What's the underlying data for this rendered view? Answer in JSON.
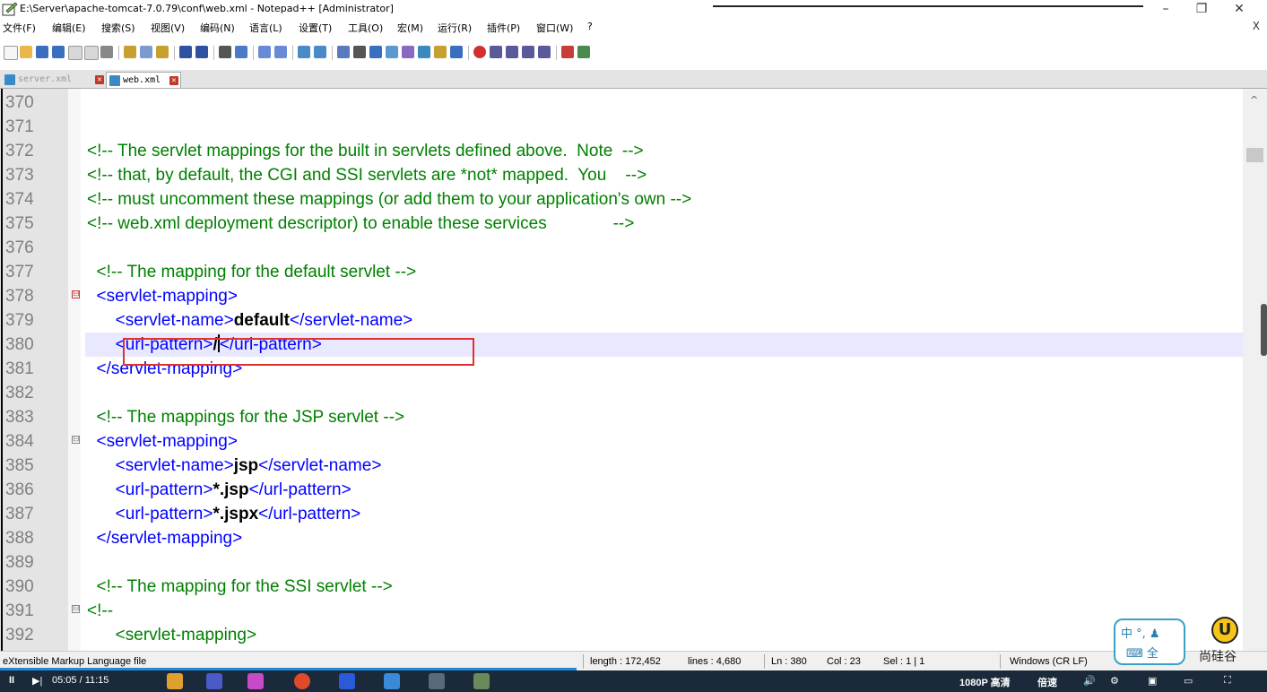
{
  "window": {
    "title": "E:\\Server\\apache-tomcat-7.0.79\\conf\\web.xml - Notepad++ [Administrator]",
    "minimize": "–",
    "restore": "❐",
    "close": "✕"
  },
  "menu": [
    {
      "label": "文件(F)"
    },
    {
      "label": "编辑(E)"
    },
    {
      "label": "搜索(S)"
    },
    {
      "label": "视图(V)"
    },
    {
      "label": "编码(N)"
    },
    {
      "label": "语言(L)"
    },
    {
      "label": "设置(T)"
    },
    {
      "label": "工具(O)"
    },
    {
      "label": "宏(M)"
    },
    {
      "label": "运行(R)"
    },
    {
      "label": "插件(P)"
    },
    {
      "label": "窗口(W)"
    },
    {
      "label": "?"
    }
  ],
  "menu_close": "X",
  "tabs": [
    {
      "label": "server.xml",
      "active": false
    },
    {
      "label": "web.xml",
      "active": true
    }
  ],
  "tab_close_glyph": "✕",
  "lines": [
    {
      "num": "370",
      "segs": []
    },
    {
      "num": "371",
      "segs": []
    },
    {
      "num": "372",
      "segs": [
        {
          "c": "cmt",
          "t": "<!-- The servlet mappings for the built in servlets defined above.  Note  -->"
        }
      ]
    },
    {
      "num": "373",
      "segs": [
        {
          "c": "cmt",
          "t": "<!-- that, by default, the CGI and SSI servlets are *not* mapped.  You    -->"
        }
      ]
    },
    {
      "num": "374",
      "segs": [
        {
          "c": "cmt",
          "t": "<!-- must uncomment these mappings (or add them to your application's own -->"
        }
      ]
    },
    {
      "num": "375",
      "segs": [
        {
          "c": "cmt",
          "t": "<!-- web.xml deployment descriptor) to enable these services              -->"
        }
      ]
    },
    {
      "num": "376",
      "segs": []
    },
    {
      "num": "377",
      "segs": [
        {
          "c": "cmt",
          "t": "  <!-- The mapping for the default servlet -->"
        }
      ]
    },
    {
      "num": "378",
      "fold": "⊟",
      "segs": [
        {
          "c": "tag",
          "t": "  <servlet-mapping>"
        }
      ]
    },
    {
      "num": "379",
      "segs": [
        {
          "c": "tag",
          "t": "      <servlet-name>"
        },
        {
          "c": "txt",
          "t": "default"
        },
        {
          "c": "tag",
          "t": "</servlet-name>"
        }
      ]
    },
    {
      "num": "380",
      "current": true,
      "segs": [
        {
          "c": "tag",
          "t": "      <url-pattern>"
        },
        {
          "c": "txt",
          "t": "/"
        },
        {
          "c": "caret",
          "t": ""
        },
        {
          "c": "tag",
          "t": "</url-pattern>"
        }
      ]
    },
    {
      "num": "381",
      "segs": [
        {
          "c": "tag",
          "t": "  </servlet-mapping>"
        }
      ]
    },
    {
      "num": "382",
      "segs": []
    },
    {
      "num": "383",
      "segs": [
        {
          "c": "cmt",
          "t": "  <!-- The mappings for the JSP servlet -->"
        }
      ]
    },
    {
      "num": "384",
      "fold": "⊟",
      "foldgray": true,
      "segs": [
        {
          "c": "tag",
          "t": "  <servlet-mapping>"
        }
      ]
    },
    {
      "num": "385",
      "segs": [
        {
          "c": "tag",
          "t": "      <servlet-name>"
        },
        {
          "c": "txt",
          "t": "jsp"
        },
        {
          "c": "tag",
          "t": "</servlet-name>"
        }
      ]
    },
    {
      "num": "386",
      "segs": [
        {
          "c": "tag",
          "t": "      <url-pattern>"
        },
        {
          "c": "txt",
          "t": "*.jsp"
        },
        {
          "c": "tag",
          "t": "</url-pattern>"
        }
      ]
    },
    {
      "num": "387",
      "segs": [
        {
          "c": "tag",
          "t": "      <url-pattern>"
        },
        {
          "c": "txt",
          "t": "*.jspx"
        },
        {
          "c": "tag",
          "t": "</url-pattern>"
        }
      ]
    },
    {
      "num": "388",
      "segs": [
        {
          "c": "tag",
          "t": "  </servlet-mapping>"
        }
      ]
    },
    {
      "num": "389",
      "segs": []
    },
    {
      "num": "390",
      "segs": [
        {
          "c": "cmt",
          "t": "  <!-- The mapping for the SSI servlet -->"
        }
      ]
    },
    {
      "num": "391",
      "fold": "⊟",
      "foldgray": true,
      "segs": [
        {
          "c": "cmt",
          "t": "<!--"
        }
      ]
    },
    {
      "num": "392",
      "segs": [
        {
          "c": "cmt",
          "t": "      <servlet-mapping>"
        }
      ]
    }
  ],
  "status": {
    "file_type": "eXtensible Markup Language file",
    "length": "length : 172,452",
    "lines": "lines : 4,680",
    "ln": "Ln : 380",
    "col": "Col : 23",
    "sel": "Sel : 1 | 1",
    "eol": "Windows (CR LF)"
  },
  "taskbar": {
    "time": "05:05 / 11:15",
    "quality": "1080P 高清",
    "speed": "倍速"
  },
  "ime": {
    "line1": "中 °, ♟",
    "line2": "⌨ 全"
  },
  "logo": {
    "mark": "U",
    "text": "尚硅谷"
  },
  "colors": {
    "comment": "#008000",
    "tag": "#0000ff",
    "highlight_box": "#e03030",
    "current_line": "#e8e8ff"
  }
}
